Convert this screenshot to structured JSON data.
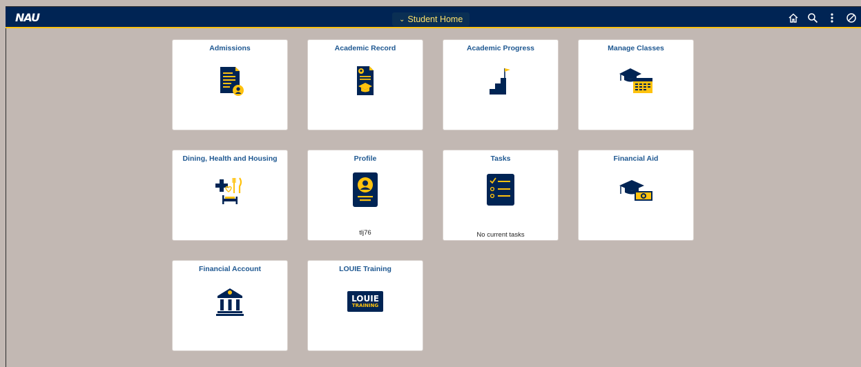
{
  "header": {
    "logo": "NAU",
    "title": "Student Home",
    "icons": [
      "home-icon",
      "search-icon",
      "more-options-icon",
      "navbar-icon"
    ]
  },
  "colors": {
    "navy": "#002454",
    "gold": "#ffc20e",
    "tile_title": "#1f5891",
    "background": "#c2b8b3"
  },
  "tiles": [
    {
      "title": "Admissions",
      "icon": "admissions-icon"
    },
    {
      "title": "Academic Record",
      "icon": "academic-record-icon"
    },
    {
      "title": "Academic Progress",
      "icon": "academic-progress-icon"
    },
    {
      "title": "Manage Classes",
      "icon": "manage-classes-icon"
    },
    {
      "title": "Dining, Health and Housing",
      "icon": "dining-health-housing-icon"
    },
    {
      "title": "Profile",
      "icon": "profile-icon",
      "sub": "tlj76"
    },
    {
      "title": "Tasks",
      "icon": "tasks-icon",
      "sub": "No current tasks"
    },
    {
      "title": "Financial Aid",
      "icon": "financial-aid-icon"
    },
    {
      "title": "Financial Account",
      "icon": "financial-account-icon"
    },
    {
      "title": "LOUIE Training",
      "icon": "louie-training-icon",
      "badge_line1": "LOUIE",
      "badge_line2": "TRAINING"
    }
  ]
}
